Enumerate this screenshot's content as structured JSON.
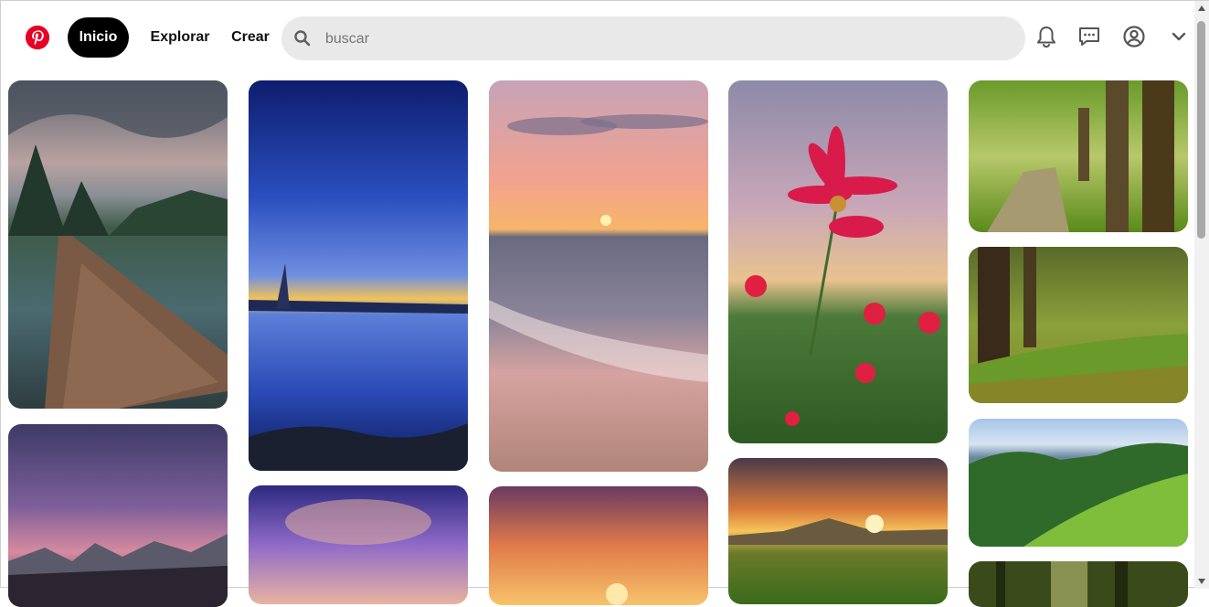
{
  "header": {
    "logo_icon": "pinterest-logo-icon",
    "nav": {
      "home": "Inicio",
      "explore": "Explorar",
      "create": "Crear"
    },
    "search": {
      "placeholder": "buscar",
      "value": ""
    },
    "icons": [
      "notifications-bell-icon",
      "messages-icon",
      "profile-icon",
      "chevron-down-icon"
    ]
  },
  "colors": {
    "brand": "#e60023",
    "active_nav": "#000000",
    "search_bg": "#e9e9e9"
  },
  "pins": [
    {
      "subject": "mountain-lake-boardwalk"
    },
    {
      "subject": "twilight-purple-mountains"
    },
    {
      "subject": "blue-sky-reflection-lake"
    },
    {
      "subject": "purple-clouds-sunset"
    },
    {
      "subject": "beach-sunset-waves"
    },
    {
      "subject": "orange-sunset-sky"
    },
    {
      "subject": "pink-cosmos-flower-field"
    },
    {
      "subject": "sunset-over-green-hills"
    },
    {
      "subject": "tree-lined-path"
    },
    {
      "subject": "autumn-forest-meadow"
    },
    {
      "subject": "green-mountain-valley"
    },
    {
      "subject": "sunlit-forest"
    }
  ]
}
